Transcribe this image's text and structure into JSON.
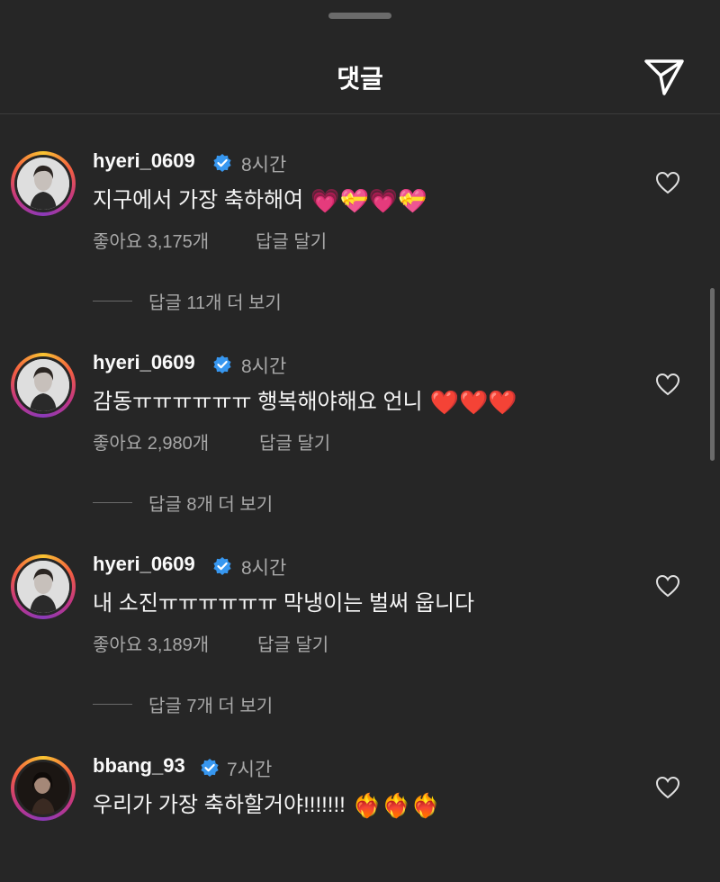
{
  "header": {
    "title": "댓글",
    "share_icon": "paper-plane-icon"
  },
  "comments": [
    {
      "username": "hyeri_0609",
      "time": "8시간",
      "text": "지구에서 가장 축하해여",
      "emojis": "💗💝💗💝",
      "likes": "좋아요 3,175개",
      "reply_label": "답글 달기",
      "more_replies": "답글 11개 더 보기"
    },
    {
      "username": "hyeri_0609",
      "time": "8시간",
      "text": "감동ㅠㅠㅠㅠㅠㅠ 행복해야해요 언니",
      "emojis": "❤️❤️❤️",
      "likes": "좋아요 2,980개",
      "reply_label": "답글 달기",
      "more_replies": "답글 8개 더 보기"
    },
    {
      "username": "hyeri_0609",
      "time": "8시간",
      "text": "내 소진ㅠㅠㅠㅠㅠㅠ 막냉이는 벌써 웁니다",
      "emojis": "",
      "likes": "좋아요 3,189개",
      "reply_label": "답글 달기",
      "more_replies": "답글 7개 더 보기"
    },
    {
      "username": "bbang_93",
      "time": "7시간",
      "text": "우리가 가장 축하할거야!!!!!!!",
      "emojis": "❤️‍🔥❤️‍🔥❤️‍🔥",
      "likes": "",
      "reply_label": "",
      "more_replies": ""
    }
  ],
  "colors": {
    "background": "#262626",
    "verified": "#3797f0",
    "secondary_text": "#a8a8a8"
  }
}
